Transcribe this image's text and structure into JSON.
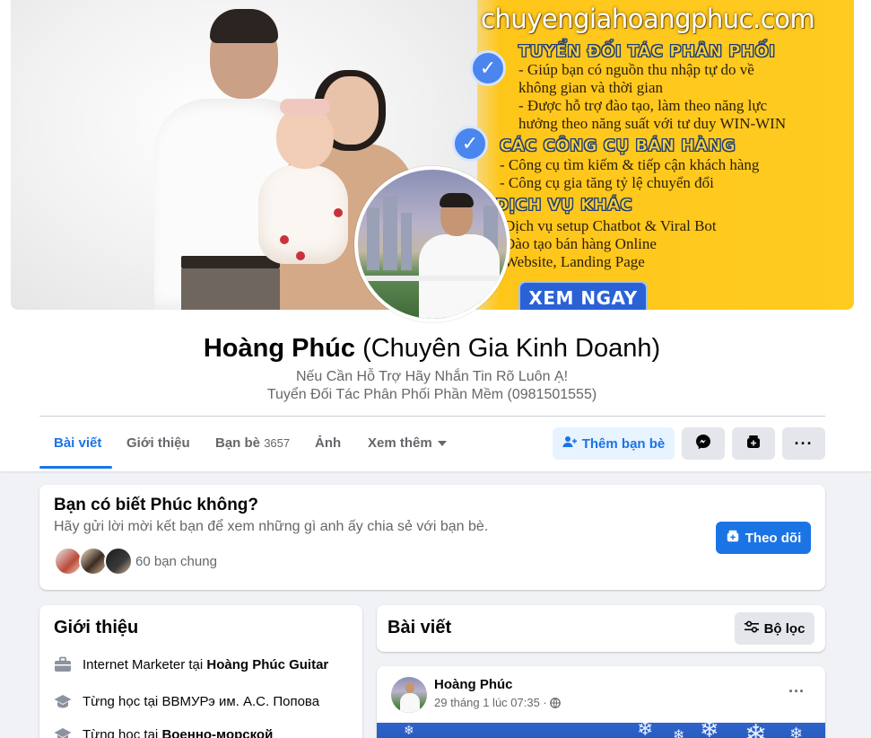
{
  "cover": {
    "promo_url": "chuyengiahoangphuc.com",
    "section1_title": "TUYỂN ĐỐI TÁC PHÂN PHỐI",
    "section1_lines": [
      "- Giúp bạn có nguồn thu nhập tự do về",
      "không gian và thời gian",
      "- Được hỗ trợ đào tạo, làm theo năng lực",
      "hưởng theo năng suất với tư duy WIN-WIN"
    ],
    "section2_title": "CÁC CÔNG CỤ BÁN HÀNG",
    "section2_lines": [
      "- Công cụ tìm kiếm & tiếp cận khách hàng",
      "- Công cụ gia tăng tỷ lệ chuyển đổi"
    ],
    "section3_title": "DỊCH VỤ KHÁC",
    "section3_lines": [
      "Dịch vụ setup Chatbot & Viral Bot",
      "Đào tạo bán hàng Online",
      "Website, Landing Page"
    ],
    "cta_label": "XEM NGAY"
  },
  "profile": {
    "name": "Hoàng Phúc",
    "alternate_name": "(Chuyên Gia Kinh Doanh)",
    "bio_line1": "Nếu Cần Hỗ Trợ Hãy Nhắn Tin Rõ Luôn Ạ!",
    "bio_line2": "Tuyển Đối Tác Phân Phối Phần Mềm (0981501555)"
  },
  "tabs": {
    "posts": "Bài viết",
    "about": "Giới thiệu",
    "friends": "Bạn bè",
    "friends_count": "3657",
    "photos": "Ảnh",
    "more": "Xem thêm"
  },
  "actions": {
    "add_friend": "Thêm bạn bè",
    "follow": "Theo dõi",
    "filter": "Bộ lọc"
  },
  "know_card": {
    "title": "Bạn có biết Phúc không?",
    "subtitle": "Hãy gửi lời mời kết bạn để xem những gì anh ấy chia sẻ với bạn bè.",
    "mutual": "60 bạn chung"
  },
  "intro": {
    "title": "Giới thiệu",
    "work_prefix": "Internet Marketer tại ",
    "work_place": "Hoàng Phúc Guitar",
    "edu1_prefix": "Từng học tại ",
    "edu1_place": "ВВМУРэ им. А.С. Попова",
    "edu2_prefix": "Từng học tại ",
    "edu2_place": "Военно-морской"
  },
  "posts": {
    "title": "Bài viết",
    "author": "Hoàng Phúc",
    "time": "29 tháng 1 lúc 07:35 ·"
  },
  "colors": {
    "accent": "#1b74e4",
    "accent_light": "#e7f3ff",
    "secondary_text": "#65676b",
    "page_bg": "#f0f2f5",
    "cover_yellow": "#ffc61a"
  }
}
